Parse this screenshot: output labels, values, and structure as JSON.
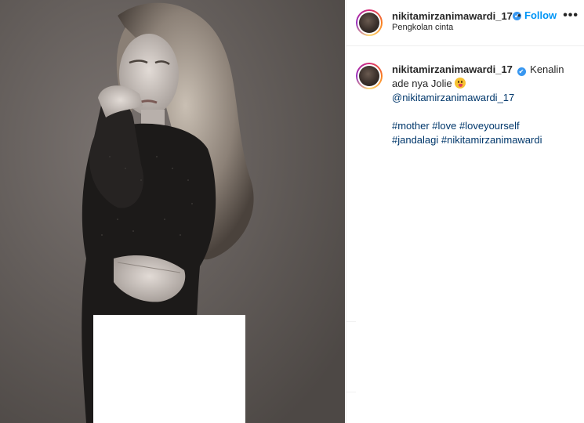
{
  "post": {
    "username": "nikitamirzanimawardi_17",
    "location": "Pengkolan cinta",
    "separator": "•",
    "follow_label": "Follow",
    "more_icon": "more-options-icon",
    "verified_icon": "verified-badge-icon",
    "verified_glyph": "✔",
    "image_alt": "Black and white portrait photo"
  },
  "caption": {
    "username": "nikitamirzanimawardi_17",
    "text_line1": "Kenalin",
    "text_line2": "ade nya Jolie",
    "emoji": "tongue-out-emoji-icon",
    "mention": "@nikitamirzanimawardi_17",
    "hashtags_line1": "#mother #love #loveyourself",
    "hashtags_line2": "#jandalagi #nikitamirzanimawardi"
  },
  "colors": {
    "accent_blue": "#0095f6",
    "link_blue": "#00376b",
    "verified_blue": "#3897f0"
  }
}
